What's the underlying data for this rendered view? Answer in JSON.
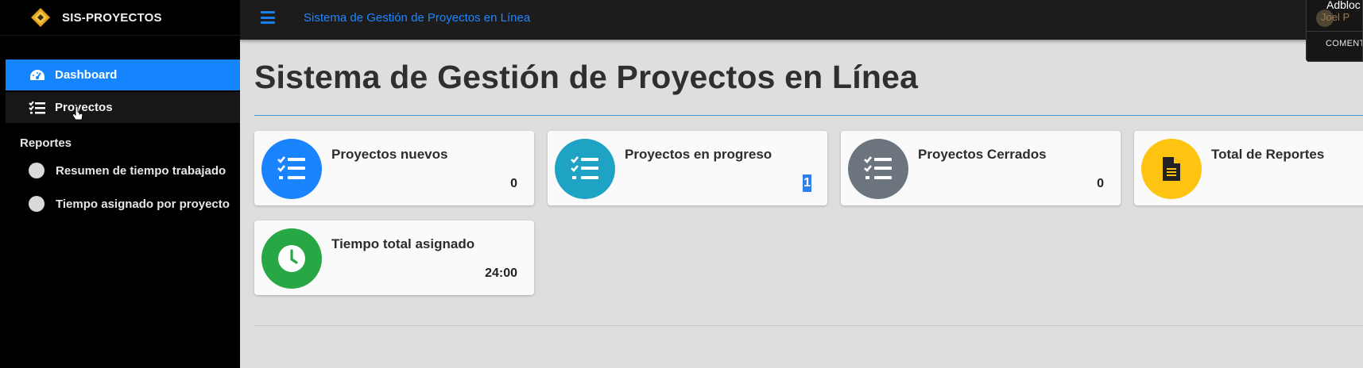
{
  "brand": {
    "name": "SIS-PROYECTOS"
  },
  "sidebar": {
    "items": [
      {
        "label": "Dashboard",
        "icon": "dashboard-icon"
      },
      {
        "label": "Proyectos",
        "icon": "list-icon"
      }
    ],
    "section_header": "Reportes",
    "sub_items": [
      {
        "label": "Resumen de tiempo trabajado"
      },
      {
        "label": "Tiempo asignado por proyecto"
      }
    ]
  },
  "topbar": {
    "title": "Sistema de Gestión de Proyectos en Línea"
  },
  "overlay": {
    "title": "Adbloc",
    "subtitle": "Joel P",
    "label": "COMENT"
  },
  "main": {
    "title": "Sistema de Gestión de Proyectos en Línea",
    "cards": [
      {
        "label": "Proyectos nuevos",
        "value": "0",
        "icon": "list-icon",
        "color": "#1a84ff"
      },
      {
        "label": "Proyectos en progreso",
        "value": "1",
        "icon": "list-icon",
        "color": "#1fa3c4"
      },
      {
        "label": "Proyectos Cerrados",
        "value": "0",
        "icon": "list-icon",
        "color": "#6c757d"
      },
      {
        "label": "Total de Reportes",
        "value": "",
        "icon": "document-icon",
        "color": "#ffc311"
      },
      {
        "label": "Tiempo total asignado",
        "value": "24:00",
        "icon": "clock-icon",
        "color": "#28a745"
      }
    ]
  }
}
